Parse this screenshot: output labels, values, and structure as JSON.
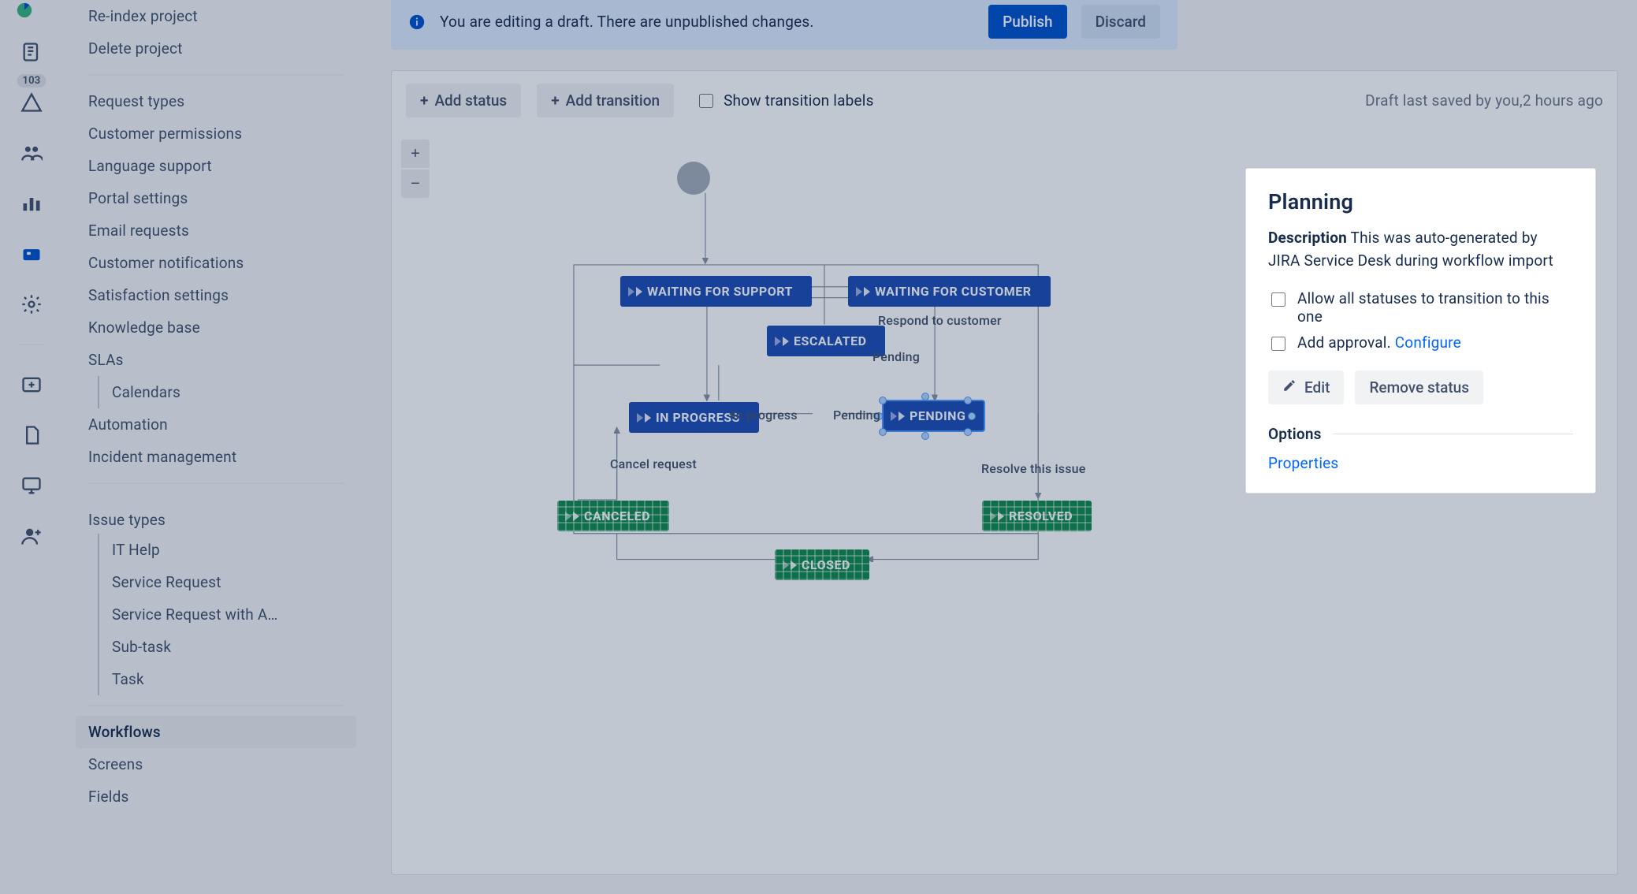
{
  "rail": {
    "badge": "103"
  },
  "sidebar": {
    "group1": [
      "Re-index project",
      "Delete project"
    ],
    "group2": [
      "Request types",
      "Customer permissions",
      "Language support",
      "Portal settings",
      "Email requests",
      "Customer notifications",
      "Satisfaction settings",
      "Knowledge base",
      "SLAs"
    ],
    "group2_sub": [
      "Calendars"
    ],
    "group2b": [
      "Automation",
      "Incident management"
    ],
    "issue_types_heading": "Issue types",
    "issue_types": [
      "IT Help",
      "Service Request",
      "Service Request with A…",
      "Sub-task",
      "Task"
    ],
    "group3": [
      "Workflows",
      "Screens",
      "Fields"
    ],
    "selected": "Workflows"
  },
  "notice": {
    "text": "You are editing a draft. There are unpublished changes.",
    "publish": "Publish",
    "discard": "Discard"
  },
  "toolbar": {
    "add_status": "Add status",
    "add_transition": "Add transition",
    "show_labels": "Show transition labels",
    "draft_prefix": "Draft last saved by you,",
    "draft_time": "2 hours ago"
  },
  "workflow": {
    "nodes": {
      "waiting_support": "WAITING FOR SUPPORT",
      "waiting_customer": "WAITING FOR CUSTOMER",
      "escalated": "ESCALATED",
      "in_progress": "IN PROGRESS",
      "pending": "PENDING",
      "canceled": "CANCELED",
      "resolved": "RESOLVED",
      "closed": "CLOSED"
    },
    "labels": {
      "respond": "Respond to customer",
      "pending1": "Pending",
      "in_progress": "In progress",
      "pending2": "Pending",
      "cancel": "Cancel request",
      "resolve": "Resolve this issue"
    }
  },
  "detail": {
    "title": "Planning",
    "desc_label": "Description",
    "desc_text": "This was auto-generated by JIRA Service Desk during workflow import",
    "allow_all": "Allow all statuses to transition to this one",
    "add_approval": "Add approval.",
    "configure": "Configure",
    "edit": "Edit",
    "remove": "Remove status",
    "options": "Options",
    "properties": "Properties"
  }
}
